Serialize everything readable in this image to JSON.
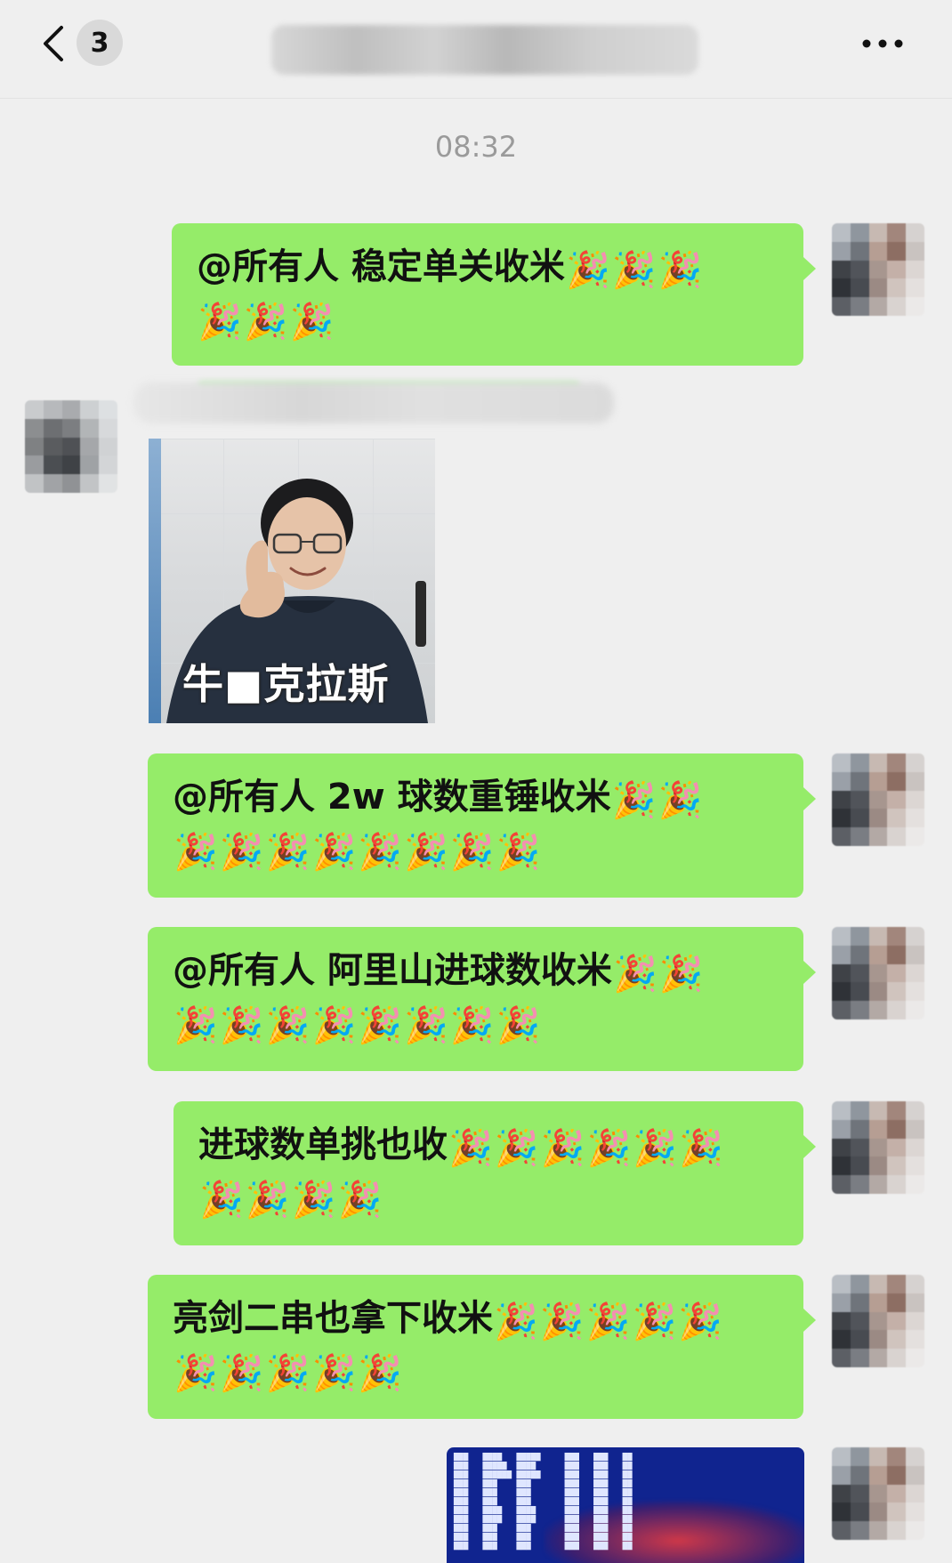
{
  "nav": {
    "unread_count": "3"
  },
  "timestamp": "08:32",
  "messages": [
    {
      "text": "@所有人  稳定单关收米",
      "emoji": [
        "🎉",
        "🎉",
        "🎉",
        "🎉",
        "🎉",
        "🎉"
      ]
    },
    {
      "text": "@所有人  2w 球数重锤收米",
      "emoji": [
        "🎉",
        "🎉",
        "🎉",
        "🎉",
        "🎉",
        "🎉",
        "🎉",
        "🎉",
        "🎉",
        "🎉"
      ]
    },
    {
      "text": "@所有人  阿里山进球数收米",
      "emoji": [
        "🎉",
        "🎉",
        "🎉",
        "🎉",
        "🎉",
        "🎉",
        "🎉",
        "🎉",
        "🎉",
        "🎉"
      ]
    },
    {
      "text": "进球数单挑也收",
      "emoji": [
        "🎉",
        "🎉",
        "🎉",
        "🎉",
        "🎉",
        "🎉",
        "🎉",
        "🎉",
        "🎉",
        "🎉"
      ]
    },
    {
      "text": "亮剑二串也拿下收米",
      "emoji": [
        "🎉",
        "🎉",
        "🎉",
        "🎉",
        "🎉",
        "🎉",
        "🎉",
        "🎉",
        "🎉",
        "🎉"
      ]
    }
  ],
  "meme": {
    "caption": "牛■克拉斯"
  },
  "icons": {
    "back": "chevron-left-icon",
    "more": "more-dots-icon",
    "emoji": "party-popper-icon"
  },
  "colors": {
    "background": "#efefef",
    "bubble_green": "#95ec69",
    "timestamp_gray": "#9a9a9a"
  }
}
